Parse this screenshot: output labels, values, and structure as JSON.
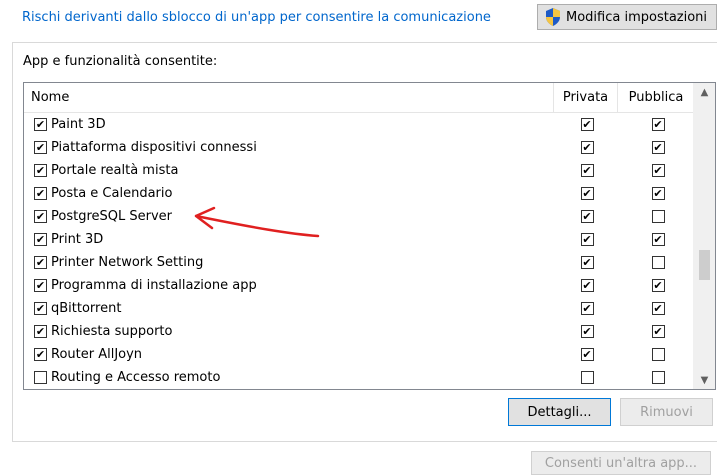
{
  "header": {
    "risk_link": "Rischi derivanti dallo sblocco di un'app per consentire la comunicazione",
    "modify_button": "Modifica impostazioni"
  },
  "group": {
    "label": "App e funzionalità consentite:"
  },
  "columns": {
    "name": "Nome",
    "private": "Privata",
    "public": "Pubblica"
  },
  "apps": [
    {
      "name": "Paint 3D",
      "enabled": true,
      "private": true,
      "public": true
    },
    {
      "name": "Piattaforma dispositivi connessi",
      "enabled": true,
      "private": true,
      "public": true
    },
    {
      "name": "Portale realtà mista",
      "enabled": true,
      "private": true,
      "public": true
    },
    {
      "name": "Posta e Calendario",
      "enabled": true,
      "private": true,
      "public": true
    },
    {
      "name": "PostgreSQL Server",
      "enabled": true,
      "private": true,
      "public": false
    },
    {
      "name": "Print 3D",
      "enabled": true,
      "private": true,
      "public": true
    },
    {
      "name": "Printer Network Setting",
      "enabled": true,
      "private": true,
      "public": false
    },
    {
      "name": "Programma di installazione app",
      "enabled": true,
      "private": true,
      "public": true
    },
    {
      "name": "qBittorrent",
      "enabled": true,
      "private": true,
      "public": true
    },
    {
      "name": "Richiesta supporto",
      "enabled": true,
      "private": true,
      "public": true
    },
    {
      "name": "Router AllJoyn",
      "enabled": true,
      "private": true,
      "public": false
    },
    {
      "name": "Routing e Accesso remoto",
      "enabled": false,
      "private": false,
      "public": false
    }
  ],
  "scroll": {
    "position": 0.62
  },
  "buttons": {
    "details": "Dettagli...",
    "remove": "Rimuovi",
    "allow_other": "Consenti un'altra app..."
  },
  "annotation": {
    "color": "#e02020"
  }
}
